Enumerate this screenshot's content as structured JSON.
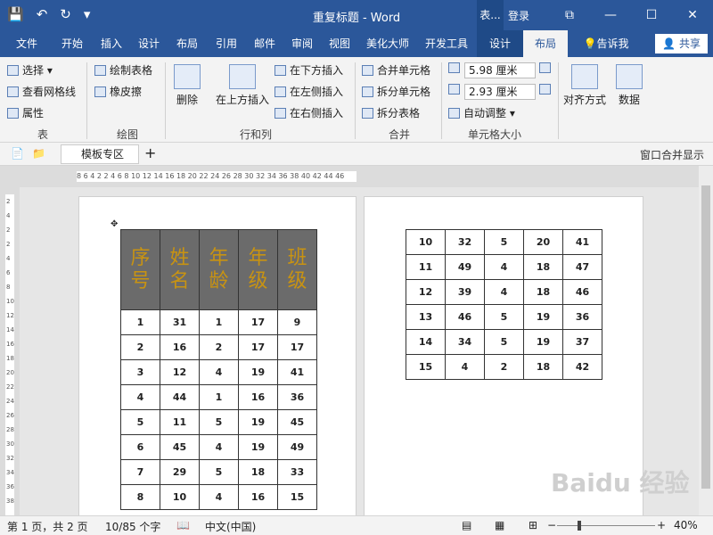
{
  "titlebar": {
    "doc_title": "重复标题 - Word",
    "context_label": "表...",
    "login": "登录",
    "save_icon": "💾",
    "undo_icon": "↶",
    "redo_icon": "↻",
    "more_icon": "▾",
    "restore_icon": "⧉",
    "min_icon": "—",
    "max_icon": "☐",
    "close_icon": "✕"
  },
  "tabs": [
    "文件",
    "开始",
    "插入",
    "设计",
    "布局",
    "引用",
    "邮件",
    "审阅",
    "视图",
    "美化大师",
    "开发工具",
    "设计",
    "布局"
  ],
  "tell_me": "告诉我",
  "share": "共享",
  "ribbon": {
    "select": "选择 ▾",
    "gridlines": "查看网格线",
    "properties": "属性",
    "draw_table": "绘制表格",
    "eraser": "橡皮擦",
    "delete": "删除",
    "insert_above": "在上方插入",
    "insert_below": "在下方插入",
    "insert_left": "在左侧插入",
    "insert_right": "在右侧插入",
    "merge_cells": "合并单元格",
    "split_cells": "拆分单元格",
    "split_table": "拆分表格",
    "height": "5.98 厘米",
    "width": "2.93 厘米",
    "autofit": "自动调整 ▾",
    "align": "对齐方式",
    "data": "数据",
    "groups": [
      "表",
      "绘图",
      "行和列",
      "合并",
      "单元格大小"
    ]
  },
  "docbar": {
    "template": "模板专区",
    "add": "+",
    "merge_window": "窗口合并显示"
  },
  "ruler_text": "8 6 4 2  2 4 6 8 10 12 14 16 18 20 22 24 26 28 30 32 34 36 38 40 42 44 46",
  "vruler": [
    "2",
    "4",
    "2",
    "2",
    "4",
    "6",
    "8",
    "10",
    "12",
    "14",
    "16",
    "18",
    "20",
    "22",
    "24",
    "26",
    "28",
    "30",
    "32",
    "34",
    "36",
    "38"
  ],
  "table1": {
    "headers": [
      "序号",
      "姓名",
      "年龄",
      "年级",
      "班级"
    ],
    "rows": [
      [
        "1",
        "31",
        "1",
        "17",
        "9"
      ],
      [
        "2",
        "16",
        "2",
        "17",
        "17"
      ],
      [
        "3",
        "12",
        "4",
        "19",
        "41"
      ],
      [
        "4",
        "44",
        "1",
        "16",
        "36"
      ],
      [
        "5",
        "11",
        "5",
        "19",
        "45"
      ],
      [
        "6",
        "45",
        "4",
        "19",
        "49"
      ],
      [
        "7",
        "29",
        "5",
        "18",
        "33"
      ],
      [
        "8",
        "10",
        "4",
        "16",
        "15"
      ]
    ]
  },
  "table2": {
    "rows": [
      [
        "10",
        "32",
        "5",
        "20",
        "41"
      ],
      [
        "11",
        "49",
        "4",
        "18",
        "47"
      ],
      [
        "12",
        "39",
        "4",
        "18",
        "46"
      ],
      [
        "13",
        "46",
        "5",
        "19",
        "36"
      ],
      [
        "14",
        "34",
        "5",
        "19",
        "37"
      ],
      [
        "15",
        "4",
        "2",
        "18",
        "42"
      ]
    ]
  },
  "status": {
    "page": "第 1 页，共 2 页",
    "words": "10/85 个字",
    "lang": "中文(中国)",
    "zoom": "40%"
  },
  "watermark": "Baidu 经验"
}
